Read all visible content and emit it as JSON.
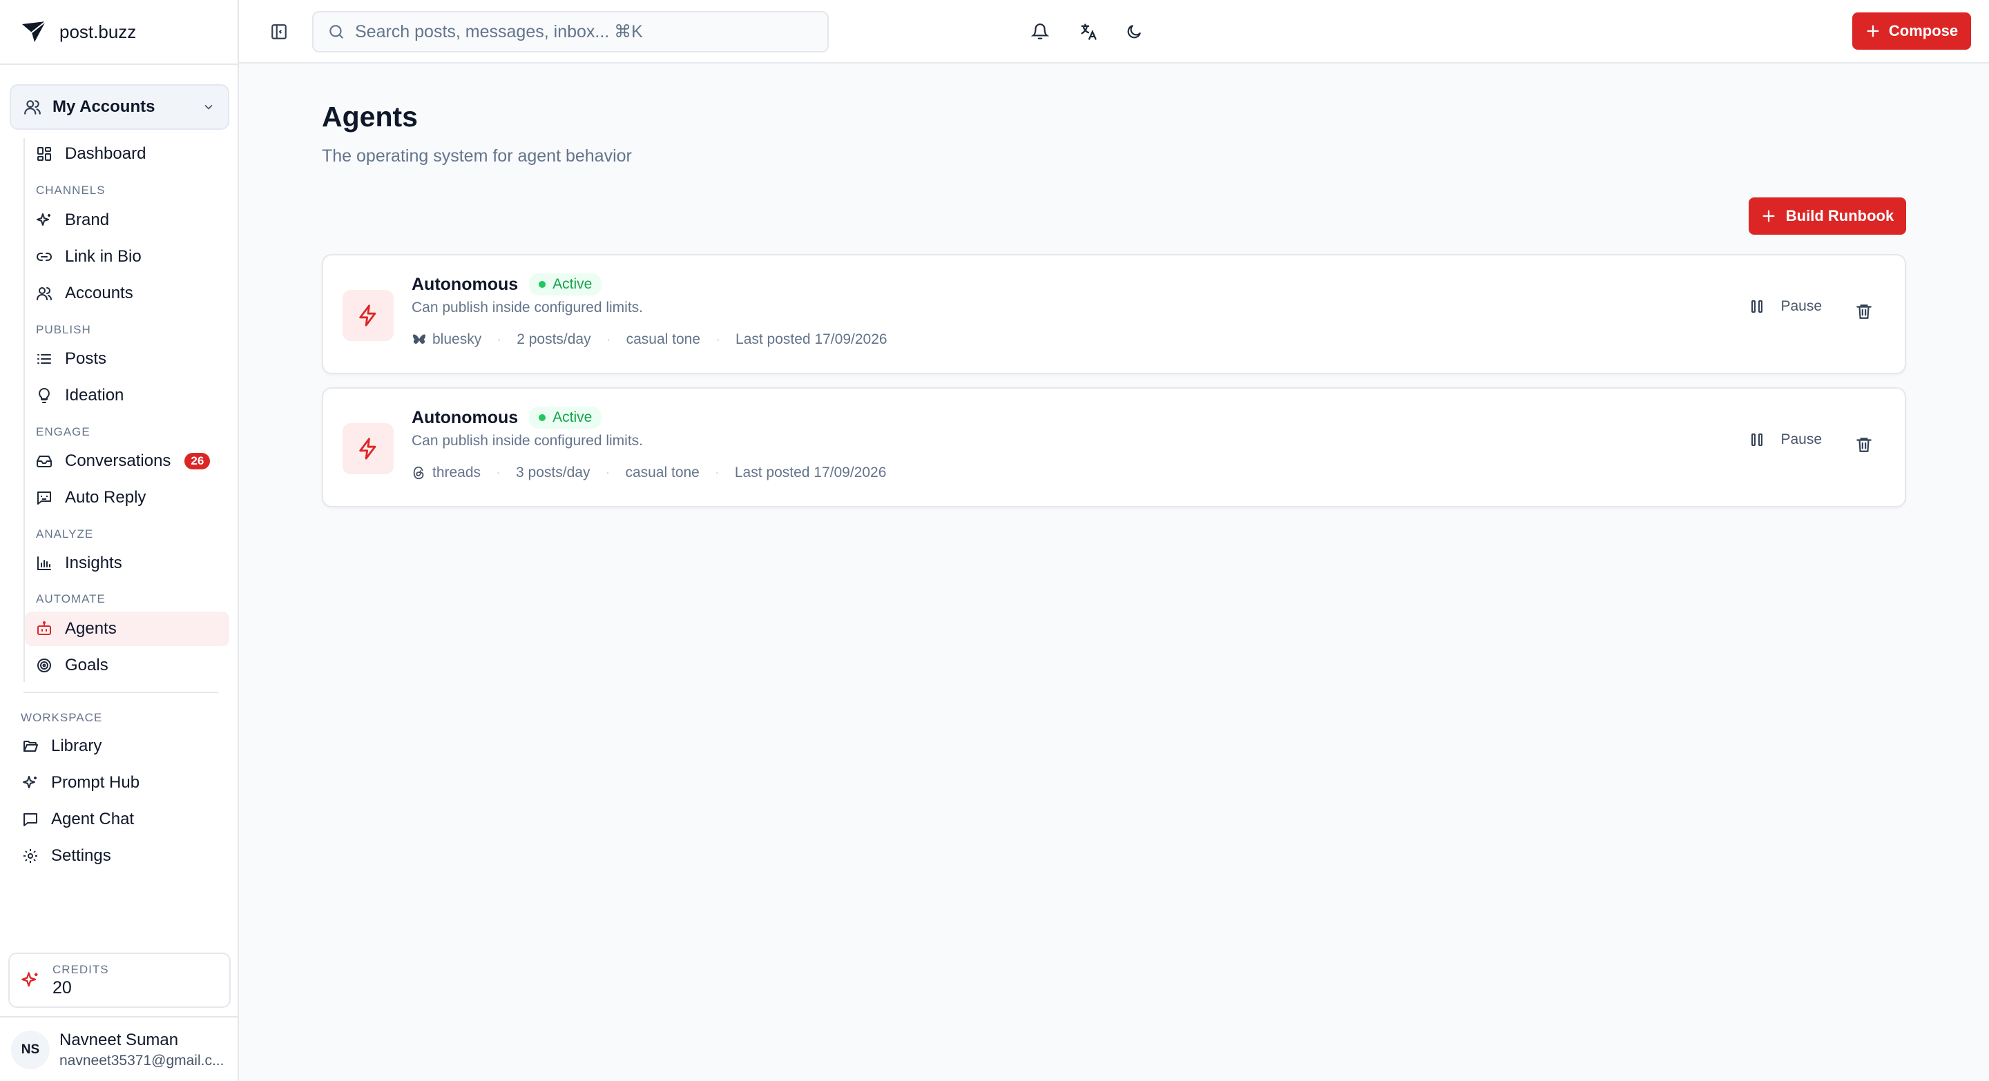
{
  "app": {
    "name": "post.buzz"
  },
  "account_switcher": {
    "label": "My Accounts"
  },
  "nav": {
    "dashboard": "Dashboard",
    "sections": {
      "channels": "CHANNELS",
      "publish": "PUBLISH",
      "engage": "ENGAGE",
      "analyze": "ANALYZE",
      "automate": "AUTOMATE",
      "workspace": "WORKSPACE"
    },
    "brand": "Brand",
    "link_in_bio": "Link in Bio",
    "accounts": "Accounts",
    "posts": "Posts",
    "ideation": "Ideation",
    "conversations": "Conversations",
    "conversations_badge": "26",
    "auto_reply": "Auto Reply",
    "insights": "Insights",
    "agents": "Agents",
    "goals": "Goals",
    "library": "Library",
    "prompt_hub": "Prompt Hub",
    "agent_chat": "Agent Chat",
    "settings": "Settings",
    "active_item": "Agents"
  },
  "credits": {
    "label": "CREDITS",
    "value": "20"
  },
  "user": {
    "initials": "NS",
    "name": "Navneet Suman",
    "email": "navneet35371@gmail.c..."
  },
  "topbar": {
    "search_placeholder": "Search posts, messages, inbox... ⌘K",
    "compose_label": "Compose"
  },
  "page": {
    "title": "Agents",
    "subtitle": "The operating system for agent behavior",
    "build_button": "Build Runbook"
  },
  "agents": [
    {
      "name": "Autonomous",
      "status": "Active",
      "description": "Can publish inside configured limits.",
      "platform": "bluesky",
      "frequency": "2 posts/day",
      "tone": "casual tone",
      "last_posted": "Last posted 17/09/2026",
      "pause_label": "Pause"
    },
    {
      "name": "Autonomous",
      "status": "Active",
      "description": "Can publish inside configured limits.",
      "platform": "threads",
      "frequency": "3 posts/day",
      "tone": "casual tone",
      "last_posted": "Last posted 17/09/2026",
      "pause_label": "Pause"
    }
  ],
  "colors": {
    "accent": "#dc2626",
    "active_bg": "#fdeef0",
    "status_green": "#16a34a",
    "background": "#f8fafc"
  },
  "icons": {
    "logo": "paper-plane-logo-icon",
    "toggle": "sidebar-toggle-icon",
    "search": "search-icon",
    "bell": "bell-icon",
    "translate": "translate-icon",
    "theme": "moon-icon",
    "bolt": "bolt-icon",
    "pause": "pause-icon",
    "trash": "trash-icon"
  }
}
